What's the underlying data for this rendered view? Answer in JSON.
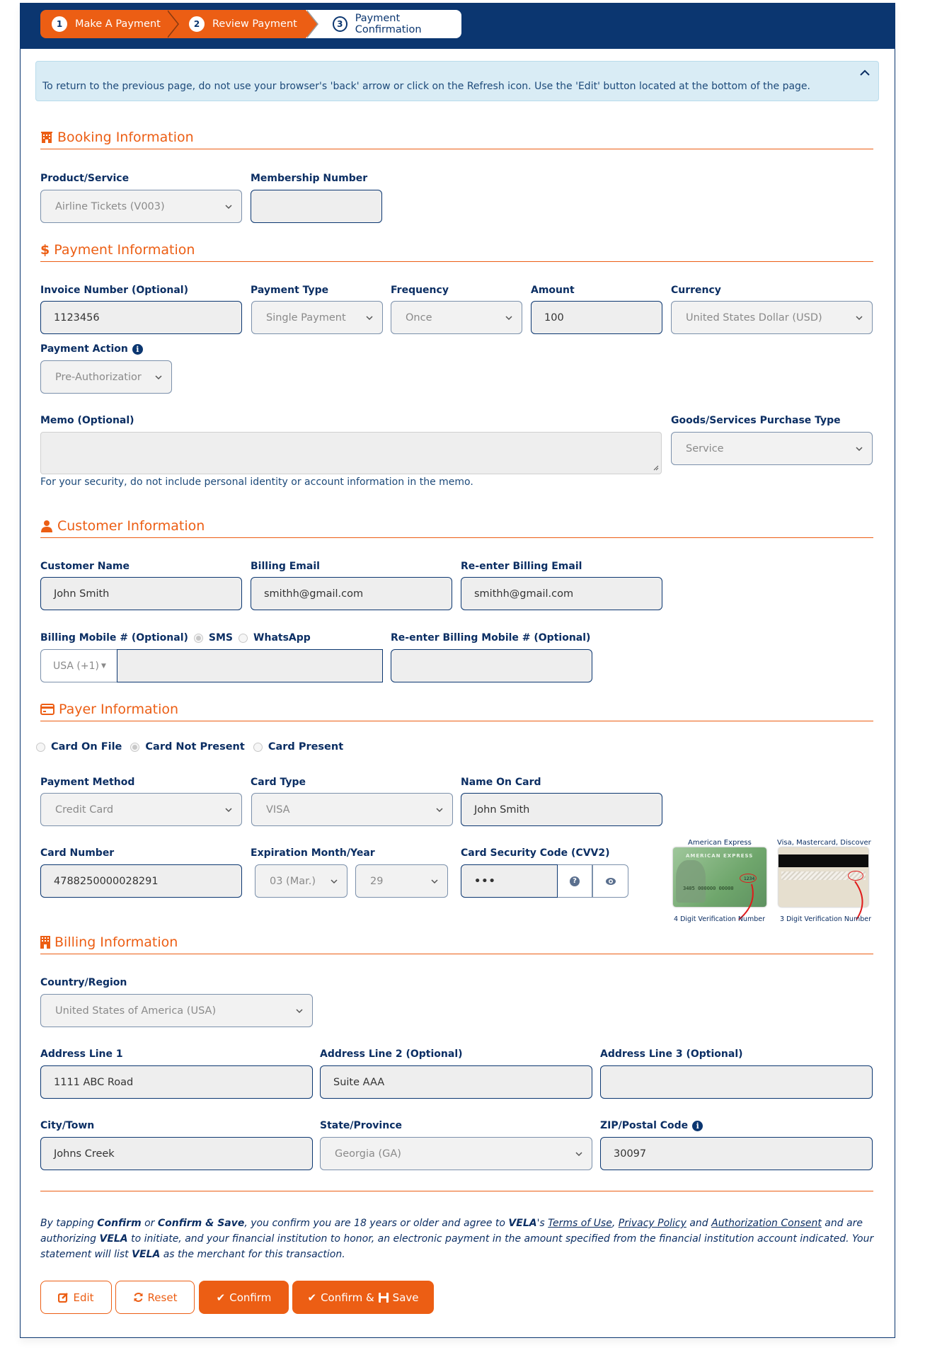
{
  "stepper": {
    "steps": [
      {
        "number": "1",
        "label": "Make A Payment"
      },
      {
        "number": "2",
        "label": "Review Payment"
      },
      {
        "number": "3",
        "label": "Payment Confirmation"
      }
    ]
  },
  "alert": {
    "text": "To return to the previous page, do not use your browser's 'back' arrow or click on the Refresh icon. Use the 'Edit' button located at the bottom of the page.",
    "collapse_icon": "chevron-up-icon"
  },
  "booking": {
    "title": "Booking Information",
    "product_label": "Product/Service",
    "product_value": "Airline Tickets (V003)",
    "membership_label": "Membership Number",
    "membership_value": ""
  },
  "payment": {
    "title": "Payment Information",
    "invoice_label": "Invoice Number (Optional)",
    "invoice_value": "1123456",
    "type_label": "Payment Type",
    "type_value": "Single Payment",
    "frequency_label": "Frequency",
    "frequency_value": "Once",
    "amount_label": "Amount",
    "amount_value": "100",
    "currency_label": "Currency",
    "currency_value": "United States Dollar (USD)",
    "action_label": "Payment Action",
    "action_value": "Pre-Authorizatior",
    "memo_label": "Memo (Optional)",
    "memo_value": "",
    "memo_help": "For your security, do not include personal identity or account information in the memo.",
    "purchase_type_label": "Goods/Services Purchase Type",
    "purchase_type_value": "Service"
  },
  "customer": {
    "title": "Customer Information",
    "name_label": "Customer Name",
    "name_value": "John Smith",
    "email_label": "Billing Email",
    "email_value": "smithh@gmail.com",
    "email2_label": "Re-enter Billing Email",
    "email2_value": "smithh@gmail.com",
    "mobile_label": "Billing Mobile # (Optional)",
    "sms_label": "SMS",
    "whatsapp_label": "WhatsApp",
    "country_code": "USA (+1)",
    "mobile_value": "",
    "mobile2_label": "Re-enter Billing Mobile # (Optional)",
    "mobile2_value": ""
  },
  "payer": {
    "title": "Payer Information",
    "radios": [
      {
        "label": "Card On File",
        "checked": false
      },
      {
        "label": "Card Not Present",
        "checked": true
      },
      {
        "label": "Card Present",
        "checked": false
      }
    ],
    "method_label": "Payment Method",
    "method_value": "Credit Card",
    "card_type_label": "Card Type",
    "card_type_value": "VISA",
    "name_on_card_label": "Name On Card",
    "name_on_card_value": "John Smith",
    "card_number_label": "Card Number",
    "card_number_value": "4788250000028291",
    "expiration_label": "Expiration Month/Year",
    "exp_month_value": "03 (Mar.)",
    "exp_year_value": "29",
    "cvv_label": "Card Security Code (CVV2)",
    "cvv_value": "•••",
    "amex_title": "American Express",
    "amex_caption": "4 Digit Verification Number",
    "amex_card_text": "AMERICAN EXPRESS",
    "amex_code": "1234",
    "visa_title": "Visa, Mastercard, Discover",
    "visa_caption": "3 Digit Verification Number"
  },
  "billing": {
    "title": "Billing Information",
    "country_label": "Country/Region",
    "country_value": "United States of America (USA)",
    "addr1_label": "Address Line 1",
    "addr1_value": "1111 ABC Road",
    "addr2_label": "Address Line 2 (Optional)",
    "addr2_value": "Suite AAA",
    "addr3_label": "Address Line 3 (Optional)",
    "addr3_value": "",
    "city_label": "City/Town",
    "city_value": "Johns Creek",
    "state_label": "State/Province",
    "state_value": "Georgia (GA)",
    "zip_label": "ZIP/Postal Code",
    "zip_value": "30097"
  },
  "legal": {
    "p1": "By tapping ",
    "confirm": "Confirm",
    "or": " or ",
    "confirm_save": "Confirm & Save",
    "p2": ", you confirm you are 18 years or older and agree to ",
    "brand": "VELA",
    "p3": "'s ",
    "terms": "Terms of Use",
    "comma": ", ",
    "privacy": "Privacy Policy",
    "and": " and ",
    "consent": "Authorization Consent",
    "p4": " and are authorizing ",
    "p5": " to initiate, and your financial institution to honor, an electronic payment in the amount specified from the financial institution account indicated. Your statement will list ",
    "p6": " as the merchant for this transaction."
  },
  "buttons": {
    "edit": "Edit",
    "reset": "Reset",
    "confirm": "Confirm",
    "confirm_and": "Confirm &",
    "save": "Save"
  },
  "colors": {
    "accent": "#ec5e14",
    "navy": "#0b3670",
    "alert_bg": "#d9ecf5"
  }
}
